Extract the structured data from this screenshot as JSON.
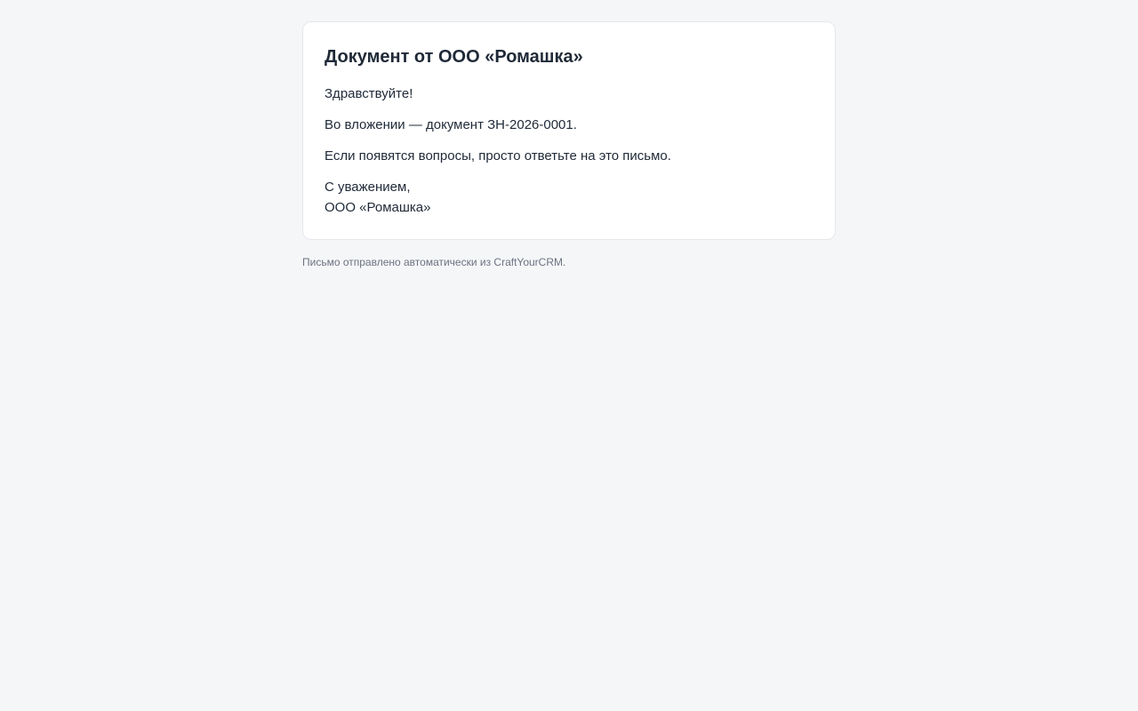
{
  "email": {
    "title": "Документ от ООО «Ромашка»",
    "greeting": "Здравствуйте!",
    "attachment_line": "Во вложении — документ ЗН-2026-0001.",
    "questions_line": "Если появятся вопросы, просто ответьте на это письмо.",
    "closing": "С уважением,",
    "signature": "ООО «Ромашка»"
  },
  "footer": {
    "note": "Письмо отправлено автоматически из CraftYourCRM."
  },
  "colors": {
    "background": "#f5f6f8",
    "card": "#ffffff",
    "text": "#1f2937",
    "muted": "#6b7280",
    "border": "#e5e7eb"
  }
}
